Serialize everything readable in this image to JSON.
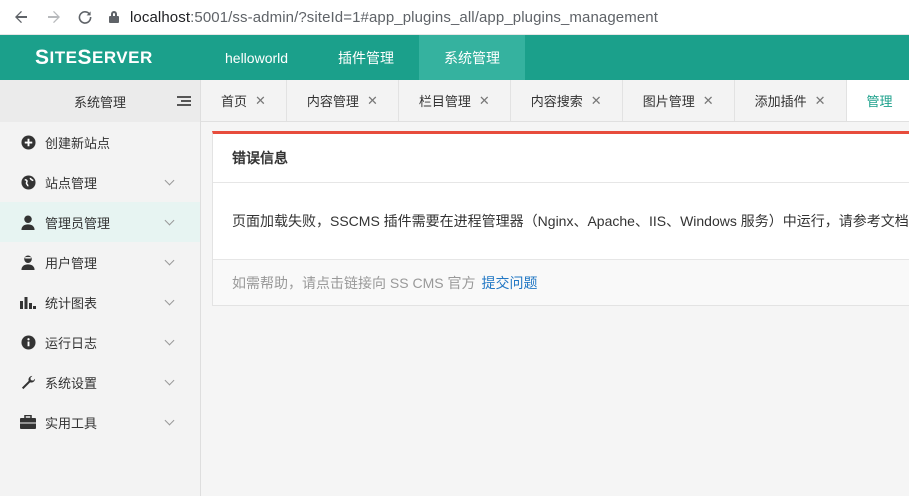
{
  "browser": {
    "url_host": "localhost",
    "url_path": ":5001/ss-admin/?siteId=1#app_plugins_all/app_plugins_management"
  },
  "brand": {
    "logo_s": "S",
    "logo_rest": "ITE",
    "logo_s2": "S",
    "logo_rest2": "ERVER"
  },
  "topnav": {
    "items": [
      "helloworld",
      "插件管理",
      "系统管理"
    ],
    "active_index": 2,
    "color": "#1ba08b"
  },
  "sidebar": {
    "title": "系统管理",
    "items": [
      {
        "label": "创建新站点",
        "icon": "plus-circle-icon"
      },
      {
        "label": "站点管理",
        "icon": "globe-icon"
      },
      {
        "label": "管理员管理",
        "icon": "user-icon"
      },
      {
        "label": "用户管理",
        "icon": "user-tie-icon"
      },
      {
        "label": "统计图表",
        "icon": "bar-chart-icon"
      },
      {
        "label": "运行日志",
        "icon": "info-icon"
      },
      {
        "label": "系统设置",
        "icon": "wrench-icon"
      },
      {
        "label": "实用工具",
        "icon": "briefcase-icon"
      }
    ]
  },
  "tabs": [
    {
      "label": "首页"
    },
    {
      "label": "内容管理"
    },
    {
      "label": "栏目管理"
    },
    {
      "label": "内容搜索"
    },
    {
      "label": "图片管理"
    },
    {
      "label": "添加插件"
    },
    {
      "label": "管理"
    }
  ],
  "panel": {
    "title": "错误信息",
    "message": "页面加载失败，SSCMS 插件需要在进程管理器（Nginx、Apache、IIS、Windows 服务）中运行，请参考文档",
    "help_text": "如需帮助，请点击链接向 SS CMS 官方",
    "help_link": "提交问题",
    "accent": "#e74c3c"
  }
}
